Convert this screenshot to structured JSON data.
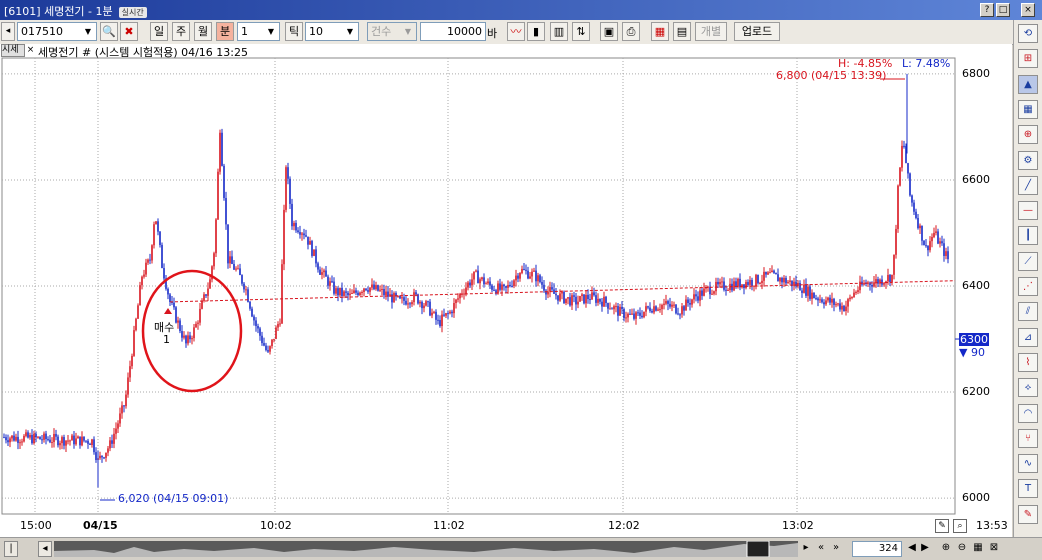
{
  "window": {
    "title": "[6101] 세명전기 - 1분",
    "status_chip": "실시간",
    "buttons": [
      "?",
      "□",
      "×"
    ]
  },
  "toolbar": {
    "code": "017510",
    "period_buttons": [
      {
        "label": "일",
        "selected": false
      },
      {
        "label": "주",
        "selected": false
      },
      {
        "label": "월",
        "selected": false
      },
      {
        "label": "분",
        "selected": true
      }
    ],
    "interval": "1",
    "tick_label": "틱",
    "tick_value": "10",
    "count_label": "건수",
    "bars_value": "10000",
    "bars_unit": "바",
    "individual_label": "개별",
    "upload_label": "업로드"
  },
  "chart_header": {
    "tab": "시세",
    "title": "세명전기 # (시스템 시험적용) 04/16 13:25"
  },
  "chart_data": {
    "type": "candlestick",
    "y_ticks": [
      6000,
      6200,
      6400,
      6600,
      6800
    ],
    "x_ticks": [
      "15:00",
      "04/15",
      "10:02",
      "11:02",
      "12:02",
      "13:02"
    ],
    "ylim": [
      5970,
      6830
    ],
    "high_annotation": "6,800 (04/15 13:39)",
    "low_annotation": "6,020 (04/15 09:01)",
    "change_high": "H: -4.85%",
    "change_low": "L: 7.48%",
    "current_price": "6300",
    "current_change": "▼ 90",
    "trade_marker": {
      "label": "매수",
      "qty": "1",
      "price": 6380
    },
    "moving_average": {
      "start": 6370,
      "end": 6410
    },
    "colors": {
      "up": "#d8141e",
      "down": "#1428c8",
      "ma": "#d8141e",
      "circle": "#e0141a"
    }
  },
  "right_toolbar": {
    "icons": [
      "refresh-icon",
      "layout-icon",
      "cursor-icon",
      "grid-icon",
      "cross-icon",
      "settings-icon",
      "trend-icon",
      "hline-icon",
      "vline-icon",
      "diagonal-icon",
      "fibo-icon",
      "channel-icon",
      "gann-icon",
      "pattern-icon",
      "fan-icon",
      "arc-icon",
      "fork-icon",
      "wave-icon",
      "text-icon",
      "pencil-icon"
    ]
  },
  "bottom": {
    "time": "13:53",
    "count": "324"
  }
}
